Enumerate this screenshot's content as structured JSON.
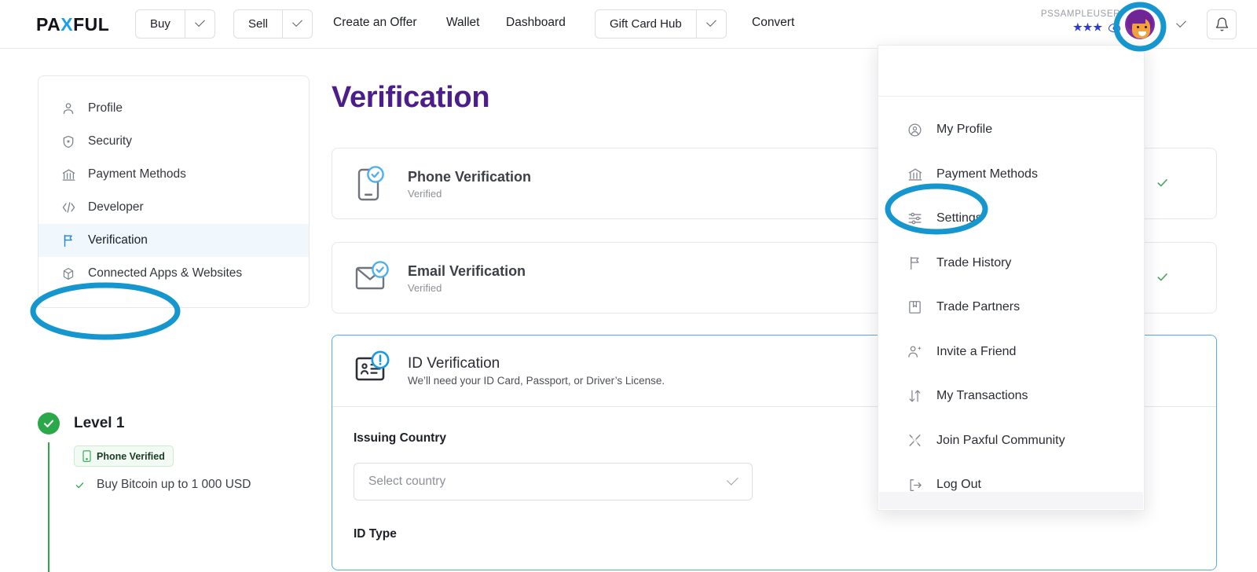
{
  "header": {
    "logo": {
      "pre": "PA",
      "slash": "X",
      "post": "FUL"
    },
    "buttons": [
      {
        "label": "Buy",
        "caret": "chevron-down-icon"
      },
      {
        "label": "Sell",
        "caret": "chevron-down-icon"
      }
    ],
    "links": [
      {
        "label": "Create an Offer"
      },
      {
        "label": "Wallet"
      },
      {
        "label": "Dashboard"
      }
    ],
    "gift_card": {
      "label": "Gift Card Hub",
      "caret": "chevron-down-icon"
    },
    "convert": {
      "label": "Convert"
    },
    "account": {
      "username": "PSSAMPLEUSER",
      "balance_masked": "★★★",
      "eye_icon": "eye-icon",
      "avatar_icon": "avatar",
      "caret_icon": "chevron-down-icon"
    },
    "bell_icon": "bell-icon"
  },
  "sidebar": {
    "items": [
      {
        "label": "Profile",
        "icon": "person-icon",
        "active": false
      },
      {
        "label": "Security",
        "icon": "shield-icon",
        "active": false
      },
      {
        "label": "Payment Methods",
        "icon": "bank-icon",
        "active": false
      },
      {
        "label": "Developer",
        "icon": "code-icon",
        "active": false
      },
      {
        "label": "Verification",
        "icon": "flag-icon",
        "active": true
      },
      {
        "label": "Connected Apps & Websites",
        "icon": "cube-icon",
        "active": false
      }
    ]
  },
  "level": {
    "status_icon": "check-circle-icon",
    "title": "Level 1",
    "badge": {
      "label": "Phone Verified",
      "icon": "phone-icon"
    },
    "perks": [
      {
        "label": "Buy Bitcoin up to 1 000 USD",
        "icon": "check-icon"
      }
    ]
  },
  "main": {
    "title": "Verification",
    "cards": [
      {
        "name": "phone",
        "icon": "phone-verified-icon",
        "title": "Phone Verification",
        "subtitle": "Verified",
        "status_icon": "green-check-icon"
      },
      {
        "name": "email",
        "icon": "email-verified-icon",
        "title": "Email Verification",
        "subtitle": "Verified",
        "status_icon": "green-check-icon"
      }
    ],
    "id_card": {
      "icon": "id-card-alert-icon",
      "title": "ID Verification",
      "subtitle": "We’ll need your ID Card, Passport, or Driver’s License.",
      "issuing_country_label": "Issuing Country",
      "country_placeholder": "Select country",
      "country_value": "",
      "country_caret": "chevron-down-icon",
      "id_type_label": "ID Type"
    }
  },
  "dropdown": {
    "items": [
      {
        "label": "My Profile",
        "icon": "person-circle-icon"
      },
      {
        "label": "Payment Methods",
        "icon": "bank-icon"
      },
      {
        "label": "Settings",
        "icon": "sliders-icon"
      },
      {
        "label": "Trade History",
        "icon": "flag-icon"
      },
      {
        "label": "Trade Partners",
        "icon": "bookmark-icon"
      },
      {
        "label": "Invite a Friend",
        "icon": "person-plus-icon"
      },
      {
        "label": "My Transactions",
        "icon": "arrows-updown-icon"
      },
      {
        "label": "Join Paxful Community",
        "icon": "x-community-icon"
      },
      {
        "label": "Log Out",
        "icon": "logout-icon"
      }
    ]
  },
  "annotations": {
    "color": "#1596ce",
    "targets": [
      {
        "name": "profile-caret",
        "shape": "ellipse"
      },
      {
        "name": "settings-menu-item",
        "shape": "ellipse"
      },
      {
        "name": "sidebar-verification",
        "shape": "ellipse"
      }
    ]
  },
  "colors": {
    "brand_purple": "#4b1e8c",
    "accent_blue": "#1aa0e8",
    "annotation_blue": "#1596ce",
    "success_green": "#2ba84a",
    "card_border": "#e6e7ea",
    "id_card_border": "#59a9e3"
  }
}
